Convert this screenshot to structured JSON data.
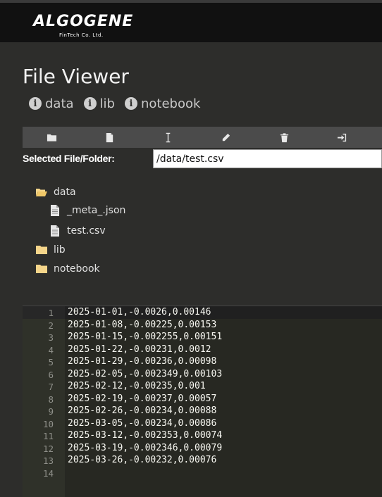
{
  "brand": {
    "name": "ALGOGENE",
    "tagline": "FinTech Co. Ltd."
  },
  "page_title": "File Viewer",
  "shortcuts": [
    {
      "label": "data"
    },
    {
      "label": "lib"
    },
    {
      "label": "notebook"
    }
  ],
  "toolbar": [
    {
      "icon": "folder-icon"
    },
    {
      "icon": "file-icon"
    },
    {
      "icon": "text-cursor-icon"
    },
    {
      "icon": "pencil-icon"
    },
    {
      "icon": "trash-icon"
    },
    {
      "icon": "sign-in-icon"
    }
  ],
  "selected": {
    "label": "Selected File/Folder:",
    "value": "/data/test.csv"
  },
  "tree": [
    {
      "label": "data",
      "icon": "folder-open-icon",
      "depth": 0
    },
    {
      "label": "_meta_.json",
      "icon": "file-icon",
      "depth": 1
    },
    {
      "label": "test.csv",
      "icon": "file-icon",
      "depth": 1
    },
    {
      "label": "lib",
      "icon": "folder-icon",
      "depth": 0
    },
    {
      "label": "notebook",
      "icon": "folder-icon",
      "depth": 0
    }
  ],
  "editor": {
    "lines": [
      "2025-01-01,-0.0026,0.00146",
      "2025-01-08,-0.00225,0.00153",
      "2025-01-15,-0.002255,0.00151",
      "2025-01-22,-0.00231,0.0012",
      "2025-01-29,-0.00236,0.00098",
      "2025-02-05,-0.002349,0.00103",
      "2025-02-12,-0.00235,0.001",
      "2025-02-19,-0.00237,0.00057",
      "2025-02-26,-0.00234,0.00088",
      "2025-03-05,-0.00234,0.00086",
      "2025-03-12,-0.002353,0.00074",
      "2025-03-19,-0.002346,0.00079",
      "2025-03-26,-0.00232,0.00076",
      ""
    ],
    "line_numbers": [
      "1",
      "2",
      "3",
      "4",
      "5",
      "6",
      "7",
      "8",
      "9",
      "10",
      "11",
      "12",
      "13",
      "14"
    ]
  }
}
